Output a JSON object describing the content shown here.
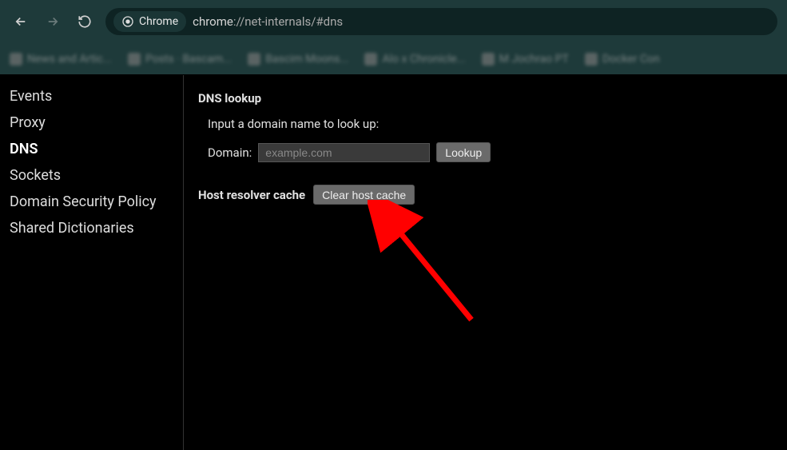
{
  "toolbar": {
    "chrome_label": "Chrome",
    "url_prefix": "chrome",
    "url_rest": "://net-internals/#dns"
  },
  "bookmarks": [
    {
      "text": "News and Artic..."
    },
    {
      "text": "Posts · Bascam..."
    },
    {
      "text": "Bascim Moons..."
    },
    {
      "text": "Alo x Chronicle..."
    },
    {
      "text": "M Jochrao PT"
    },
    {
      "text": "Docker Con"
    }
  ],
  "sidebar": {
    "items": [
      {
        "label": "Events",
        "active": false
      },
      {
        "label": "Proxy",
        "active": false
      },
      {
        "label": "DNS",
        "active": true
      },
      {
        "label": "Sockets",
        "active": false
      },
      {
        "label": "Domain Security Policy",
        "active": false
      },
      {
        "label": "Shared Dictionaries",
        "active": false
      }
    ]
  },
  "main": {
    "section_title": "DNS lookup",
    "instruction": "Input a domain name to look up:",
    "domain_label": "Domain:",
    "domain_placeholder": "example.com",
    "lookup_button": "Lookup",
    "resolver_label": "Host resolver cache",
    "clear_cache_button": "Clear host cache"
  }
}
